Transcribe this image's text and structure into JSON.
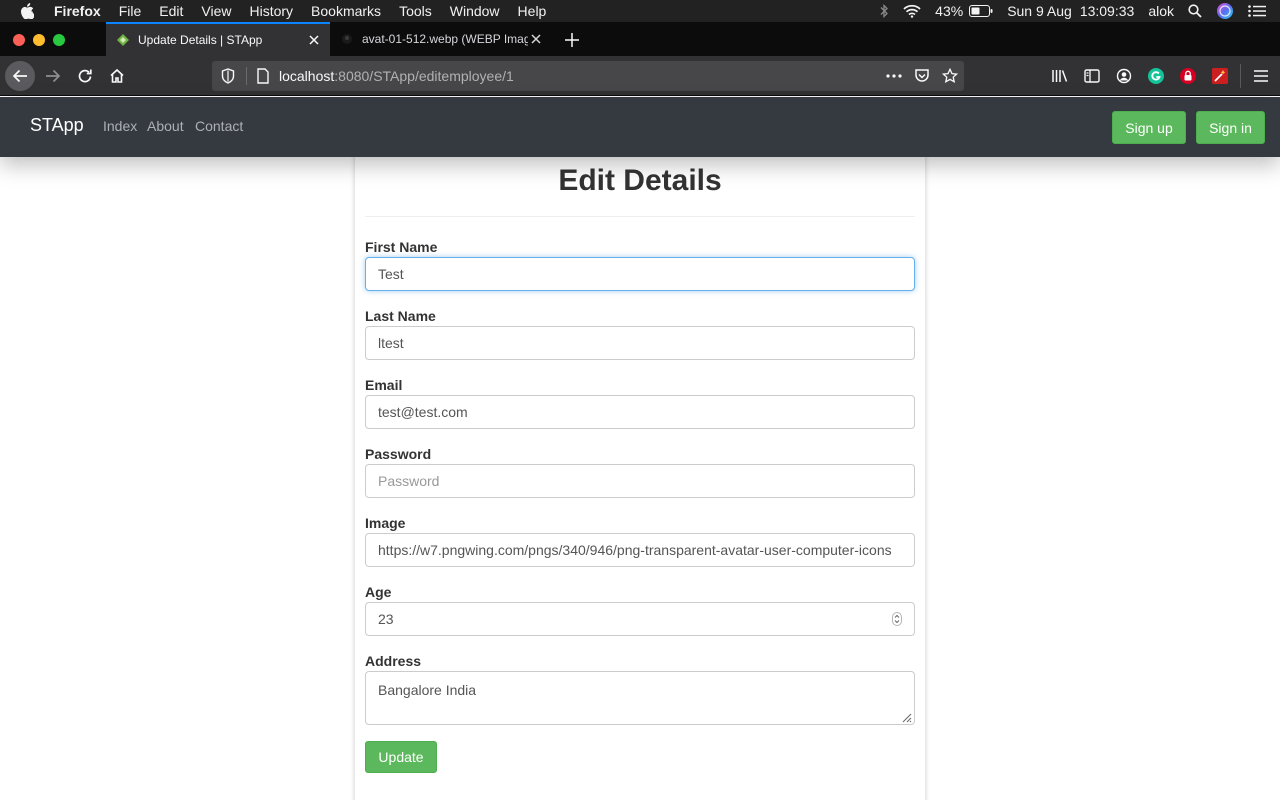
{
  "menubar": {
    "app": "Firefox",
    "items": [
      "File",
      "Edit",
      "View",
      "History",
      "Bookmarks",
      "Tools",
      "Window",
      "Help"
    ],
    "battery": "43%",
    "date": "Sun 9 Aug",
    "time": "13:09:33",
    "user": "alok"
  },
  "tabs": [
    {
      "label": "Update Details | STApp"
    },
    {
      "label": "avat-01-512.webp (WEBP Image"
    }
  ],
  "urlbar": {
    "host": "localhost",
    "rest": ":8080/STApp/editemployee/1"
  },
  "site": {
    "brand": "STApp",
    "nav": [
      "Index",
      "About",
      "Contact"
    ],
    "signup": "Sign up",
    "signin": "Sign in"
  },
  "form": {
    "title": "Edit Details",
    "first_name_label": "First Name",
    "first_name_value": "Test",
    "last_name_label": "Last Name",
    "last_name_value": "ltest",
    "email_label": "Email",
    "email_value": "test@test.com",
    "password_label": "Password",
    "password_placeholder": "Password",
    "image_label": "Image",
    "image_value": "https://w7.pngwing.com/pngs/340/946/png-transparent-avatar-user-computer-icons",
    "age_label": "Age",
    "age_value": "23",
    "address_label": "Address",
    "address_value": "Bangalore India",
    "update_label": "Update"
  },
  "colors": {
    "navbar": "#343a40",
    "success": "#5cb85c",
    "focus": "#66afe9"
  }
}
